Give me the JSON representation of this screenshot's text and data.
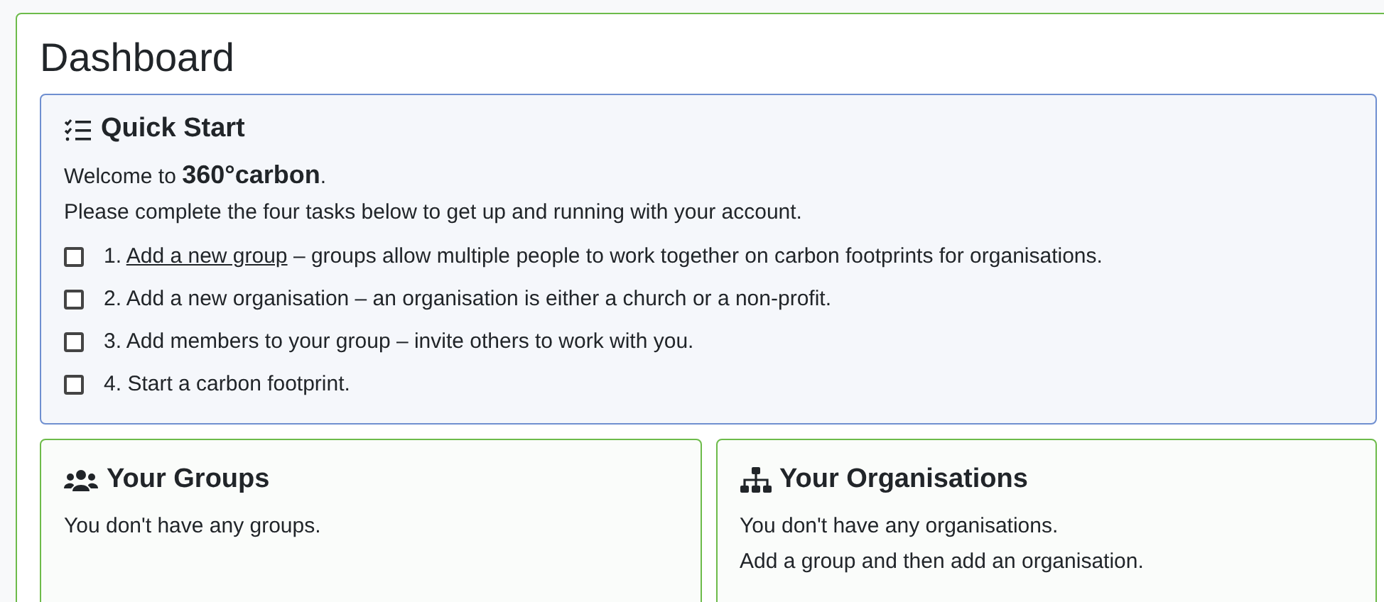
{
  "title": "Dashboard",
  "quick_start": {
    "title": "Quick Start",
    "welcome": "Welcome to **360°carbon**.",
    "intro": "Please complete the four tasks below to get up and running with your account.",
    "tasks": [
      {
        "number": "1.",
        "link": "Add a new group",
        "text": " – groups allow multiple people to work together on carbon footprints for organisations.",
        "checked": false
      },
      {
        "number": "2.",
        "text": "Add a new organisation – an organisation is either a church or a non-profit.",
        "checked": false
      },
      {
        "number": "3.",
        "text": "Add members to your group – invite others to work with you.",
        "checked": false
      },
      {
        "number": "4.",
        "text": "Start a carbon footprint.",
        "checked": false
      }
    ]
  },
  "cards": [
    {
      "kind": "groups",
      "title": "Your Groups",
      "lines": [
        "You don't have any groups."
      ]
    },
    {
      "kind": "organisations",
      "title": "Your Organisations",
      "lines": [
        "You don't have any organisations.",
        "Add a group and then add an organisation."
      ]
    }
  ]
}
